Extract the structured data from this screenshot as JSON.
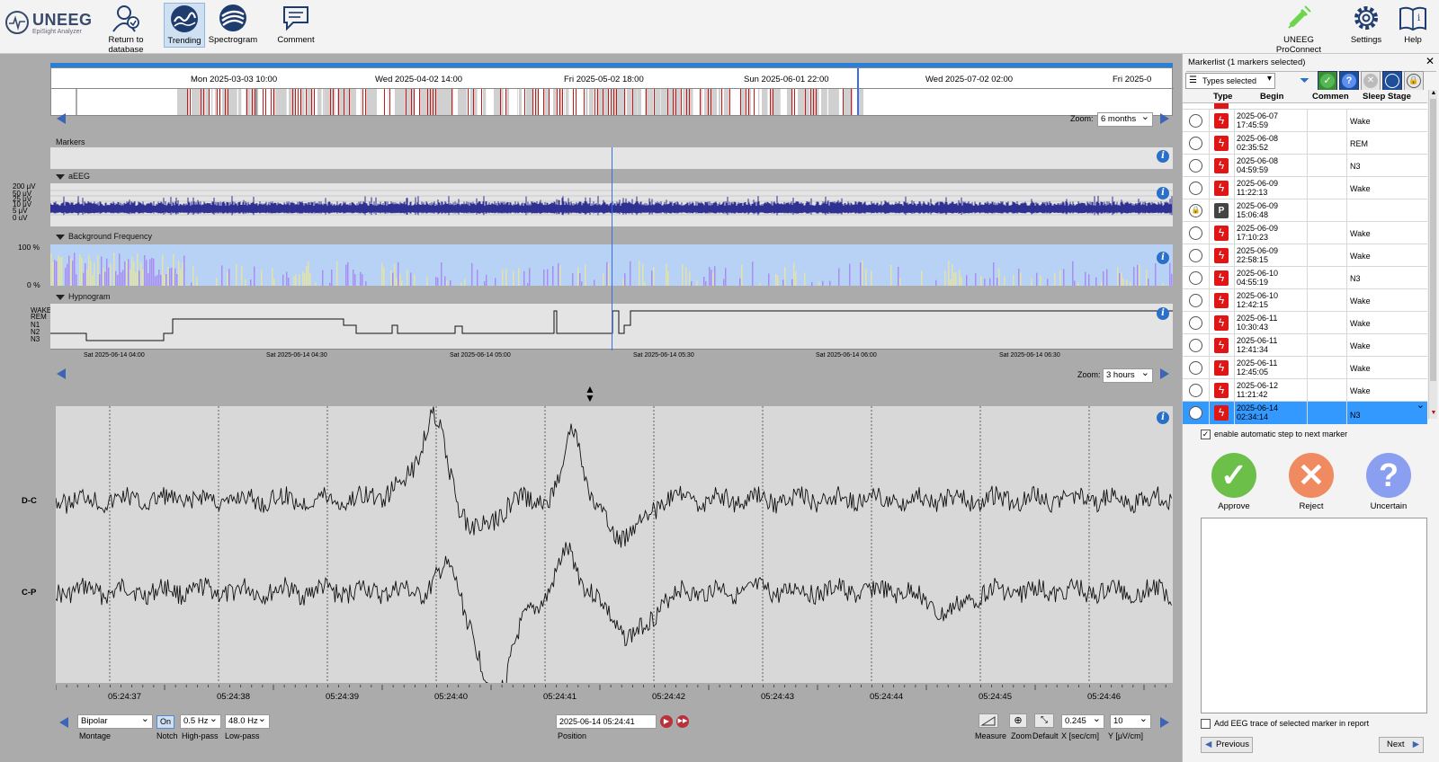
{
  "app": {
    "name": "UNEEG",
    "subtitle": "EpiSight Analyzer"
  },
  "toolbar": {
    "return_label": "Return to database",
    "trending_label": "Trending",
    "spectrogram_label": "Spectrogram",
    "comment_label": "Comment",
    "proconnect_label": "UNEEG ProConnect",
    "settings_label": "Settings",
    "help_label": "Help"
  },
  "overview": {
    "dates": [
      "Mon 2025-03-03 10:00",
      "Wed 2025-04-02 14:00",
      "Fri 2025-05-02 18:00",
      "Sun 2025-06-01 22:00",
      "Wed 2025-07-02 02:00",
      "Fri 2025-0"
    ],
    "zoom_label": "Zoom:",
    "zoom_value": "6 months"
  },
  "trend": {
    "markers_label": "Markers",
    "aeeg_label": "aEEG",
    "aeeg_scale": [
      "200 μV",
      "50 μV",
      "25 μV",
      "10 μV",
      "5 μV",
      "0 uV"
    ],
    "bgfreq_label": "Background Frequency",
    "bgfreq_scale": [
      "100 %",
      "0 %"
    ],
    "hypnogram_label": "Hypnogram",
    "hyp_stages": [
      "WAKE",
      "REM",
      "N1",
      "N2",
      "N3"
    ],
    "times": [
      "Sat 2025-06-14 04:00",
      "Sat 2025-06-14 04:30",
      "Sat 2025-06-14 05:00",
      "Sat 2025-06-14 05:30",
      "Sat 2025-06-14 06:00",
      "Sat 2025-06-14 06:30"
    ],
    "zoom_label": "Zoom:",
    "zoom_value": "3 hours"
  },
  "eeg": {
    "channels": [
      "D-C",
      "C-P"
    ],
    "times": [
      "05:24:37",
      "05:24:38",
      "05:24:39",
      "05:24:40",
      "05:24:41",
      "05:24:42",
      "05:24:43",
      "05:24:44",
      "05:24:45",
      "05:24:46"
    ]
  },
  "bottom": {
    "montage_value": "Bipolar",
    "montage_label": "Montage",
    "notch_value": "On",
    "notch_label": "Notch",
    "highpass_value": "0.5 Hz",
    "highpass_label": "High-pass",
    "lowpass_value": "48.0 Hz",
    "lowpass_label": "Low-pass",
    "position_value": "2025-06-14 05:24:41",
    "position_label": "Position",
    "measure_label": "Measure",
    "zoom_label": "Zoom",
    "default_label": "Default",
    "x_value": "0.245",
    "x_label": "X [sec/cm]",
    "y_value": "10",
    "y_label": "Y [μV/cm]"
  },
  "markerlist": {
    "title": "Markerlist (1 markers selected)",
    "filter_value": "Types selected",
    "columns": [
      "Type",
      "Begin",
      "Commen",
      "Sleep Stage"
    ],
    "rows": [
      {
        "date": "2025-06-07",
        "time": "17:45:59",
        "stage": "Wake",
        "kind": "seizure"
      },
      {
        "date": "2025-06-08",
        "time": "02:35:52",
        "stage": "REM",
        "kind": "seizure"
      },
      {
        "date": "2025-06-08",
        "time": "04:59:59",
        "stage": "N3",
        "kind": "seizure"
      },
      {
        "date": "2025-06-09",
        "time": "11:22:13",
        "stage": "Wake",
        "kind": "seizure"
      },
      {
        "date": "2025-06-09",
        "time": "15:06:48",
        "stage": "",
        "kind": "pushbutton"
      },
      {
        "date": "2025-06-09",
        "time": "17:10:23",
        "stage": "Wake",
        "kind": "seizure"
      },
      {
        "date": "2025-06-09",
        "time": "22:58:15",
        "stage": "Wake",
        "kind": "seizure"
      },
      {
        "date": "2025-06-10",
        "time": "04:55:19",
        "stage": "N3",
        "kind": "seizure"
      },
      {
        "date": "2025-06-10",
        "time": "12:42:15",
        "stage": "Wake",
        "kind": "seizure"
      },
      {
        "date": "2025-06-11",
        "time": "10:30:43",
        "stage": "Wake",
        "kind": "seizure"
      },
      {
        "date": "2025-06-11",
        "time": "12:41:34",
        "stage": "Wake",
        "kind": "seizure"
      },
      {
        "date": "2025-06-11",
        "time": "12:45:05",
        "stage": "Wake",
        "kind": "seizure"
      },
      {
        "date": "2025-06-12",
        "time": "11:21:42",
        "stage": "Wake",
        "kind": "seizure"
      },
      {
        "date": "2025-06-14",
        "time": "02:34:14",
        "stage": "N3",
        "kind": "seizure"
      }
    ],
    "auto_step_label": "enable automatic step to next marker",
    "approve_label": "Approve",
    "reject_label": "Reject",
    "uncertain_label": "Uncertain",
    "add_trace_label": "Add EEG trace of selected marker in report",
    "previous_label": "Previous",
    "next_label": "Next"
  },
  "colors": {
    "accent": "#3399ff",
    "seizure": "#e01515",
    "approve": "#6cc04a",
    "reject": "#f08a60",
    "uncertain": "#8a9ff0",
    "aeeg": "#2e3191"
  }
}
